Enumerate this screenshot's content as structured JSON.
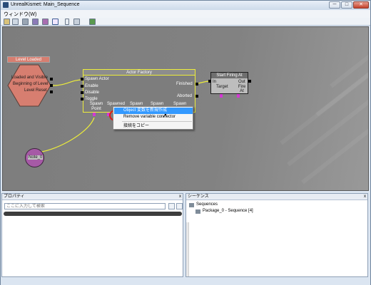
{
  "window": {
    "title": "UnrealKismet: Main_Sequence",
    "min_glyph": "─",
    "max_glyph": "□",
    "close_glyph": "✕"
  },
  "menubar": {
    "window_menu": "ウィンドウ(W)"
  },
  "toolbar": {
    "icons": [
      "open-sequence-icon",
      "parent-sequence-icon",
      "hide-connectors-icon",
      "show-connectors-icon",
      "search-icon",
      "update-icon",
      "zoom-icon",
      "create-comment-icon",
      "kismet-icon"
    ]
  },
  "graph": {
    "level_loaded": {
      "title": "Level Loaded",
      "outputs": [
        "Loaded and Visible",
        "Beginning of Level",
        "Level Reset"
      ]
    },
    "actor_factory": {
      "title": "Actor Factory",
      "inputs": [
        "Spawn Actor",
        "Enable",
        "Disable",
        "Toggle"
      ],
      "outputs": [
        "Finished",
        "Aborted"
      ],
      "variables": [
        "Spawn Point",
        "Spawned",
        "Spawn",
        "Spawn",
        "Spawn"
      ]
    },
    "start_firing": {
      "title": "Start Firing At",
      "input": "In",
      "output": "Out",
      "variables": [
        "Target",
        "Fire At"
      ]
    },
    "note_var": {
      "label": "Note_0"
    }
  },
  "context_menu": {
    "items": [
      "Object 変数を新規作成",
      "Remove variable connector",
      "接続をコピー"
    ]
  },
  "panels": {
    "properties": {
      "title": "プロパティ",
      "close": "x",
      "search_placeholder": "ここに入力して検索"
    },
    "sequences": {
      "title": "シーケンス",
      "close": "x",
      "root": "Sequences",
      "child": "Package_0 - Sequence [4]"
    }
  },
  "colors": {
    "graph_bg": "#828282",
    "event_node": "#d77e70",
    "action_node": "#b8b8b8",
    "action_header": "#7d7d7d",
    "selection": "#eded3a",
    "variable_pin": "#d23ad2",
    "menu_highlight": "#3399ff"
  }
}
